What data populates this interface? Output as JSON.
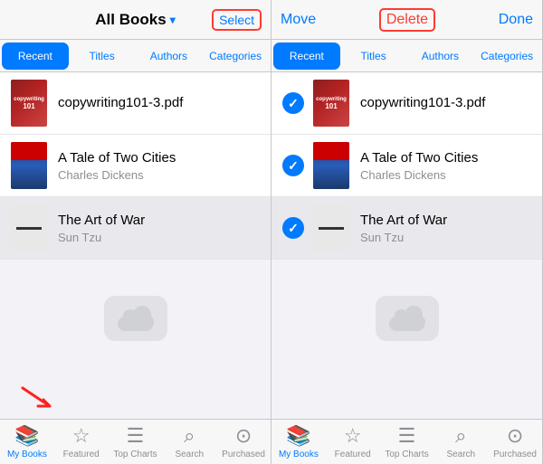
{
  "left_panel": {
    "header": {
      "title": "All Books",
      "title_dropdown": "▾",
      "select_btn": "Select"
    },
    "tabs": [
      {
        "label": "Recent",
        "active": true
      },
      {
        "label": "Titles",
        "active": false
      },
      {
        "label": "Authors",
        "active": false
      },
      {
        "label": "Categories",
        "active": false
      }
    ],
    "books": [
      {
        "title": "copywriting101-3.pdf",
        "author": "",
        "type": "pdf"
      },
      {
        "title": "A Tale of Two Cities",
        "author": "Charles Dickens",
        "type": "tale"
      },
      {
        "title": "The Art of War",
        "author": "Sun Tzu",
        "type": "war"
      }
    ],
    "nav": [
      {
        "label": "My Books",
        "active": true
      },
      {
        "label": "Featured",
        "active": false
      },
      {
        "label": "Top Charts",
        "active": false
      },
      {
        "label": "Search",
        "active": false
      },
      {
        "label": "Purchased",
        "active": false
      }
    ]
  },
  "right_panel": {
    "header": {
      "move_btn": "Move",
      "delete_btn": "Delete",
      "done_btn": "Done"
    },
    "tabs": [
      {
        "label": "Recent",
        "active": true
      },
      {
        "label": "Titles",
        "active": false
      },
      {
        "label": "Authors",
        "active": false
      },
      {
        "label": "Categories",
        "active": false
      }
    ],
    "books": [
      {
        "title": "copywriting101-3.pdf",
        "author": "",
        "type": "pdf",
        "selected": true
      },
      {
        "title": "A Tale of Two Cities",
        "author": "Charles Dickens",
        "type": "tale",
        "selected": true
      },
      {
        "title": "The Art of War",
        "author": "Sun Tzu",
        "type": "war",
        "selected": true
      }
    ],
    "nav": [
      {
        "label": "My Books",
        "active": true
      },
      {
        "label": "Featured",
        "active": false
      },
      {
        "label": "Top Charts",
        "active": false
      },
      {
        "label": "Search",
        "active": false
      },
      {
        "label": "Purchased",
        "active": false
      }
    ]
  }
}
